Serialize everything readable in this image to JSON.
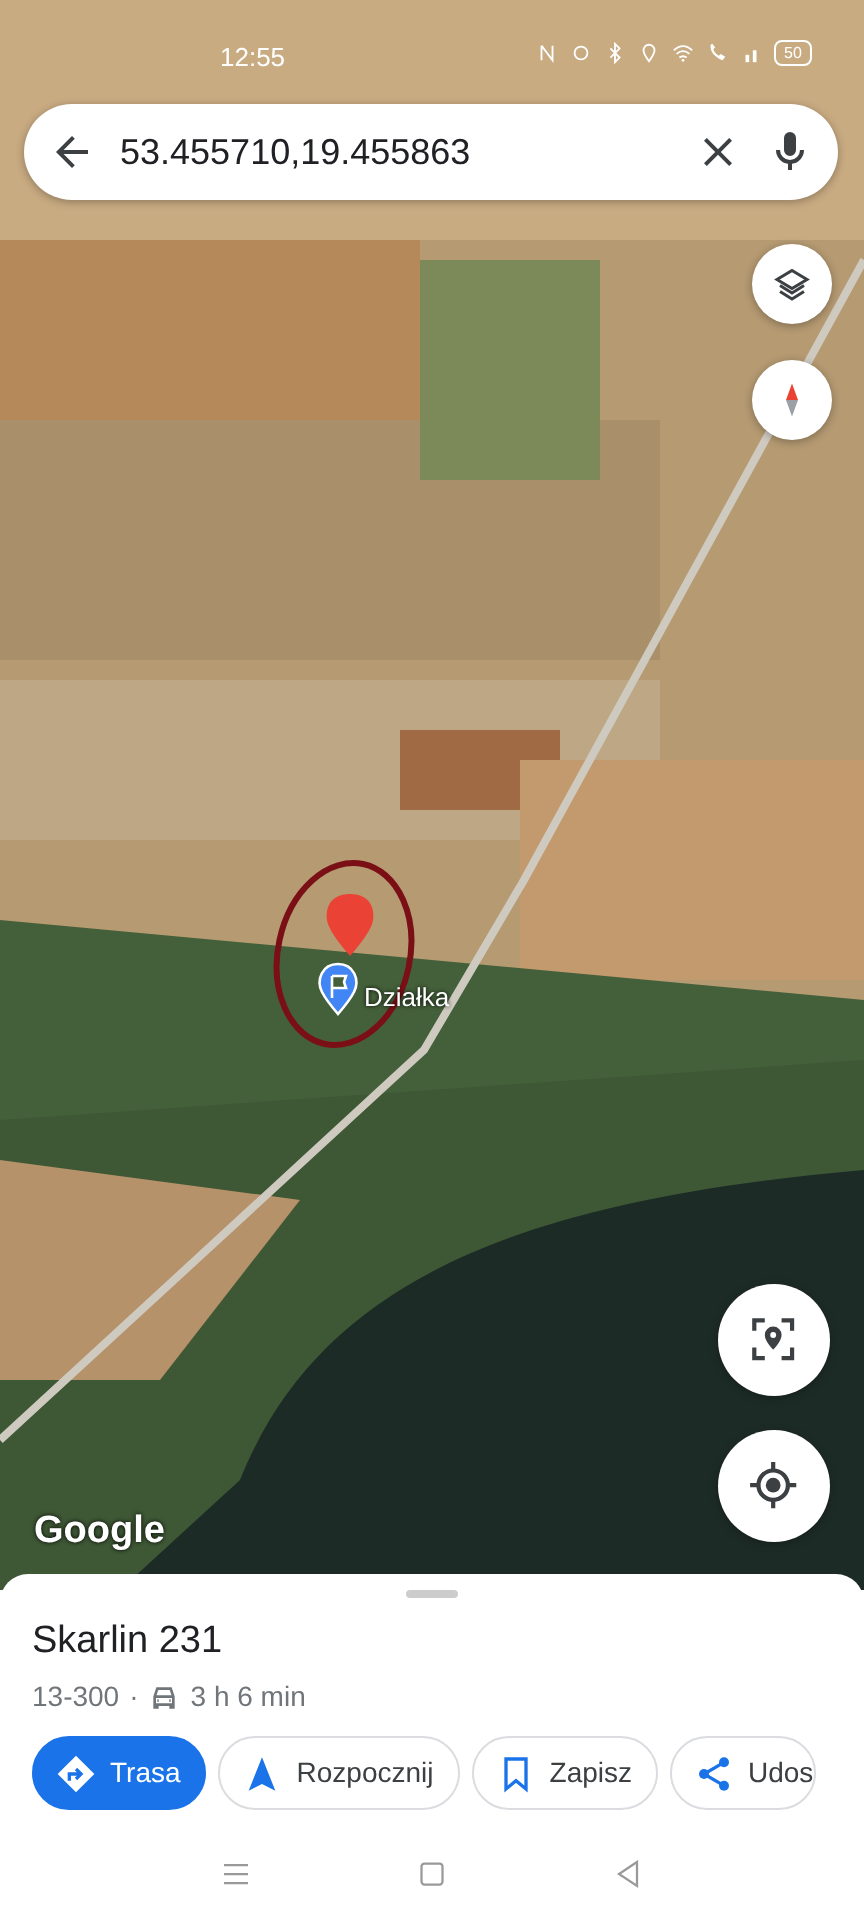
{
  "status_bar": {
    "time": "12:55",
    "battery": "50"
  },
  "search": {
    "value": "53.455710,19.455863"
  },
  "map": {
    "place_label": "Działka",
    "logo": "Google"
  },
  "place": {
    "title": "Skarlin 231",
    "postal_code": "13-300",
    "separator": "·",
    "travel_time": "3 h 6 min"
  },
  "actions": [
    {
      "kind": "directions",
      "label": "Trasa",
      "primary": true
    },
    {
      "kind": "start",
      "label": "Rozpocznij",
      "primary": false
    },
    {
      "kind": "save",
      "label": "Zapisz",
      "primary": false
    },
    {
      "kind": "share",
      "label": "Udos",
      "primary": false
    }
  ]
}
